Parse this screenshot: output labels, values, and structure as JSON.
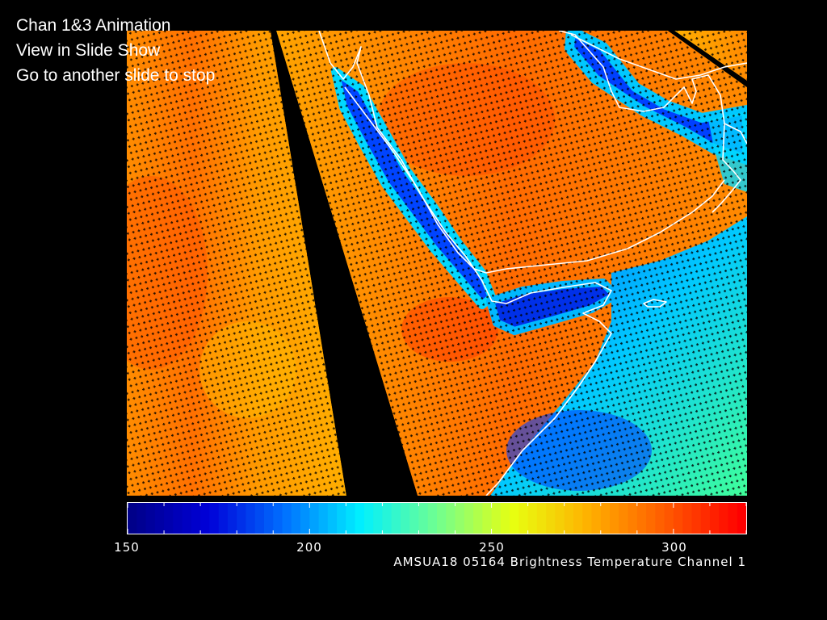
{
  "slide": {
    "title_lines": [
      "Chan 1&3 Animation",
      "View in Slide Show",
      "Go to another slide to stop"
    ]
  },
  "colorbar": {
    "min": 150,
    "max": 320,
    "tick_labels": [
      "150",
      "200",
      "250",
      "300"
    ],
    "caption": "AMSUA18 05164 Brightness Temperature Channel  1",
    "palette": [
      "#00008a",
      "#0000d8",
      "#0070ff",
      "#00f0ff",
      "#70ff90",
      "#e8ff10",
      "#ffb000",
      "#ff5a00",
      "#ff0000"
    ]
  },
  "map": {
    "background_color": "#000000",
    "coastline_color": "#ffffff",
    "sample_marker_color": "#000000"
  }
}
